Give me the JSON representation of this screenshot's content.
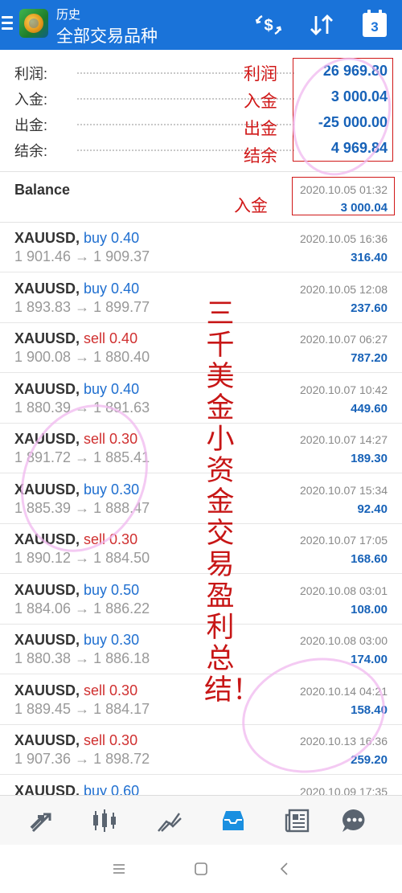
{
  "header": {
    "subtitle": "历史",
    "title": "全部交易品种",
    "calendar_day": "3"
  },
  "summary": [
    {
      "label": "利润:",
      "value": "26 969.80",
      "annotation": "利润"
    },
    {
      "label": "入金:",
      "value": "3 000.04",
      "annotation": "入金"
    },
    {
      "label": "出金:",
      "value": "-25 000.00",
      "annotation": "出金"
    },
    {
      "label": "结余:",
      "value": "4 969.84",
      "annotation": "结余"
    }
  ],
  "balance": {
    "label": "Balance",
    "annotation": "入金",
    "date": "2020.10.05 01:32",
    "amount": "3 000.04"
  },
  "trades": [
    {
      "symbol": "XAUUSD,",
      "side": "buy 0.40",
      "type": "buy",
      "prices": "1 901.46 → 1 909.37",
      "date": "2020.10.05 16:36",
      "profit": "316.40"
    },
    {
      "symbol": "XAUUSD,",
      "side": "buy 0.40",
      "type": "buy",
      "prices": "1 893.83 → 1 899.77",
      "date": "2020.10.05 12:08",
      "profit": "237.60"
    },
    {
      "symbol": "XAUUSD,",
      "side": "sell 0.40",
      "type": "sell",
      "prices": "1 900.08 → 1 880.40",
      "date": "2020.10.07 06:27",
      "profit": "787.20"
    },
    {
      "symbol": "XAUUSD,",
      "side": "buy 0.40",
      "type": "buy",
      "prices": "1 880.39 → 1 891.63",
      "date": "2020.10.07 10:42",
      "profit": "449.60"
    },
    {
      "symbol": "XAUUSD,",
      "side": "sell 0.30",
      "type": "sell",
      "prices": "1 891.72 → 1 885.41",
      "date": "2020.10.07 14:27",
      "profit": "189.30"
    },
    {
      "symbol": "XAUUSD,",
      "side": "buy 0.30",
      "type": "buy",
      "prices": "1 885.39 → 1 888.47",
      "date": "2020.10.07 15:34",
      "profit": "92.40"
    },
    {
      "symbol": "XAUUSD,",
      "side": "sell 0.30",
      "type": "sell",
      "prices": "1 890.12 → 1 884.50",
      "date": "2020.10.07 17:05",
      "profit": "168.60"
    },
    {
      "symbol": "XAUUSD,",
      "side": "buy 0.50",
      "type": "buy",
      "prices": "1 884.06 → 1 886.22",
      "date": "2020.10.08 03:01",
      "profit": "108.00"
    },
    {
      "symbol": "XAUUSD,",
      "side": "buy 0.30",
      "type": "buy",
      "prices": "1 880.38 → 1 886.18",
      "date": "2020.10.08 03:00",
      "profit": "174.00"
    },
    {
      "symbol": "XAUUSD,",
      "side": "sell 0.30",
      "type": "sell",
      "prices": "1 889.45 → 1 884.17",
      "date": "2020.10.14 04:21",
      "profit": "158.40"
    },
    {
      "symbol": "XAUUSD,",
      "side": "sell 0.30",
      "type": "sell",
      "prices": "1 907.36 → 1 898.72",
      "date": "2020.10.13 16:36",
      "profit": "259.20"
    },
    {
      "symbol": "XAUUSD,",
      "side": "buy 0.60",
      "type": "buy",
      "prices": "",
      "date": "2020.10.09 17:35",
      "profit": ""
    }
  ],
  "vertical_annotation": "三千美金小资金交易盈利总结！",
  "colors": {
    "header": "#1a73d9",
    "value_blue": "#1762b8",
    "buy": "#1f6fd0",
    "sell": "#d03030",
    "annotation_red": "#d01818",
    "active_nav": "#1a8fe0",
    "inactive_nav": "#5a6470"
  },
  "bottom_nav": [
    {
      "name": "quotes-icon",
      "active": false
    },
    {
      "name": "chart-icon",
      "active": false
    },
    {
      "name": "trade-icon",
      "active": false
    },
    {
      "name": "history-icon",
      "active": true
    },
    {
      "name": "news-icon",
      "active": false
    },
    {
      "name": "messages-icon",
      "active": false
    }
  ],
  "system_nav": [
    "recents-icon",
    "home-icon",
    "back-icon"
  ]
}
